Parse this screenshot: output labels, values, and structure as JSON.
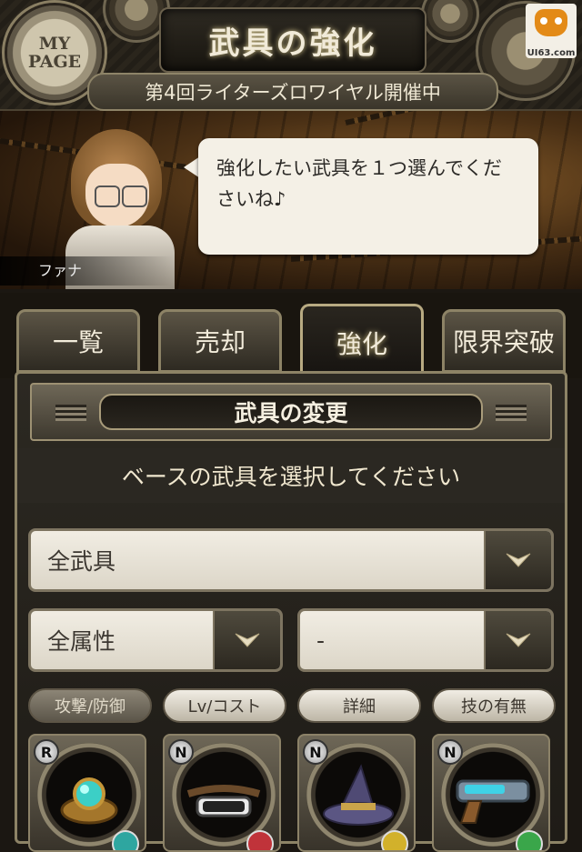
{
  "header": {
    "mypage_line1": "MY",
    "mypage_line2": "PAGE",
    "title": "武具の強化",
    "event": "第4回ライターズロワイヤル開催中",
    "logo_text": "UI63.com"
  },
  "hero": {
    "speaker": "ファナ",
    "message": "強化したい武具を１つ選んでくださいね♪"
  },
  "tabs": [
    {
      "label": "一覧",
      "active": false
    },
    {
      "label": "売却",
      "active": false
    },
    {
      "label": "強化",
      "active": true
    },
    {
      "label": "限界突破",
      "active": false
    }
  ],
  "panel": {
    "section_title": "武具の変更",
    "instruction": "ベースの武具を選択してください",
    "filter_weapon": "全武具",
    "filter_attribute": "全属性",
    "filter_other": "-",
    "sort_buttons": [
      "攻撃/防御",
      "Lv/コスト",
      "詳細",
      "技の有無"
    ],
    "cards": [
      {
        "rarity": "R",
        "item": "gem-ring-icon",
        "attr_color": "#2ea6a0"
      },
      {
        "rarity": "N",
        "item": "goggles-icon",
        "attr_color": "#c0333a"
      },
      {
        "rarity": "N",
        "item": "witch-hat-icon",
        "attr_color": "#d2b12b"
      },
      {
        "rarity": "N",
        "item": "gun-icon",
        "attr_color": "#3aa64a"
      }
    ]
  }
}
